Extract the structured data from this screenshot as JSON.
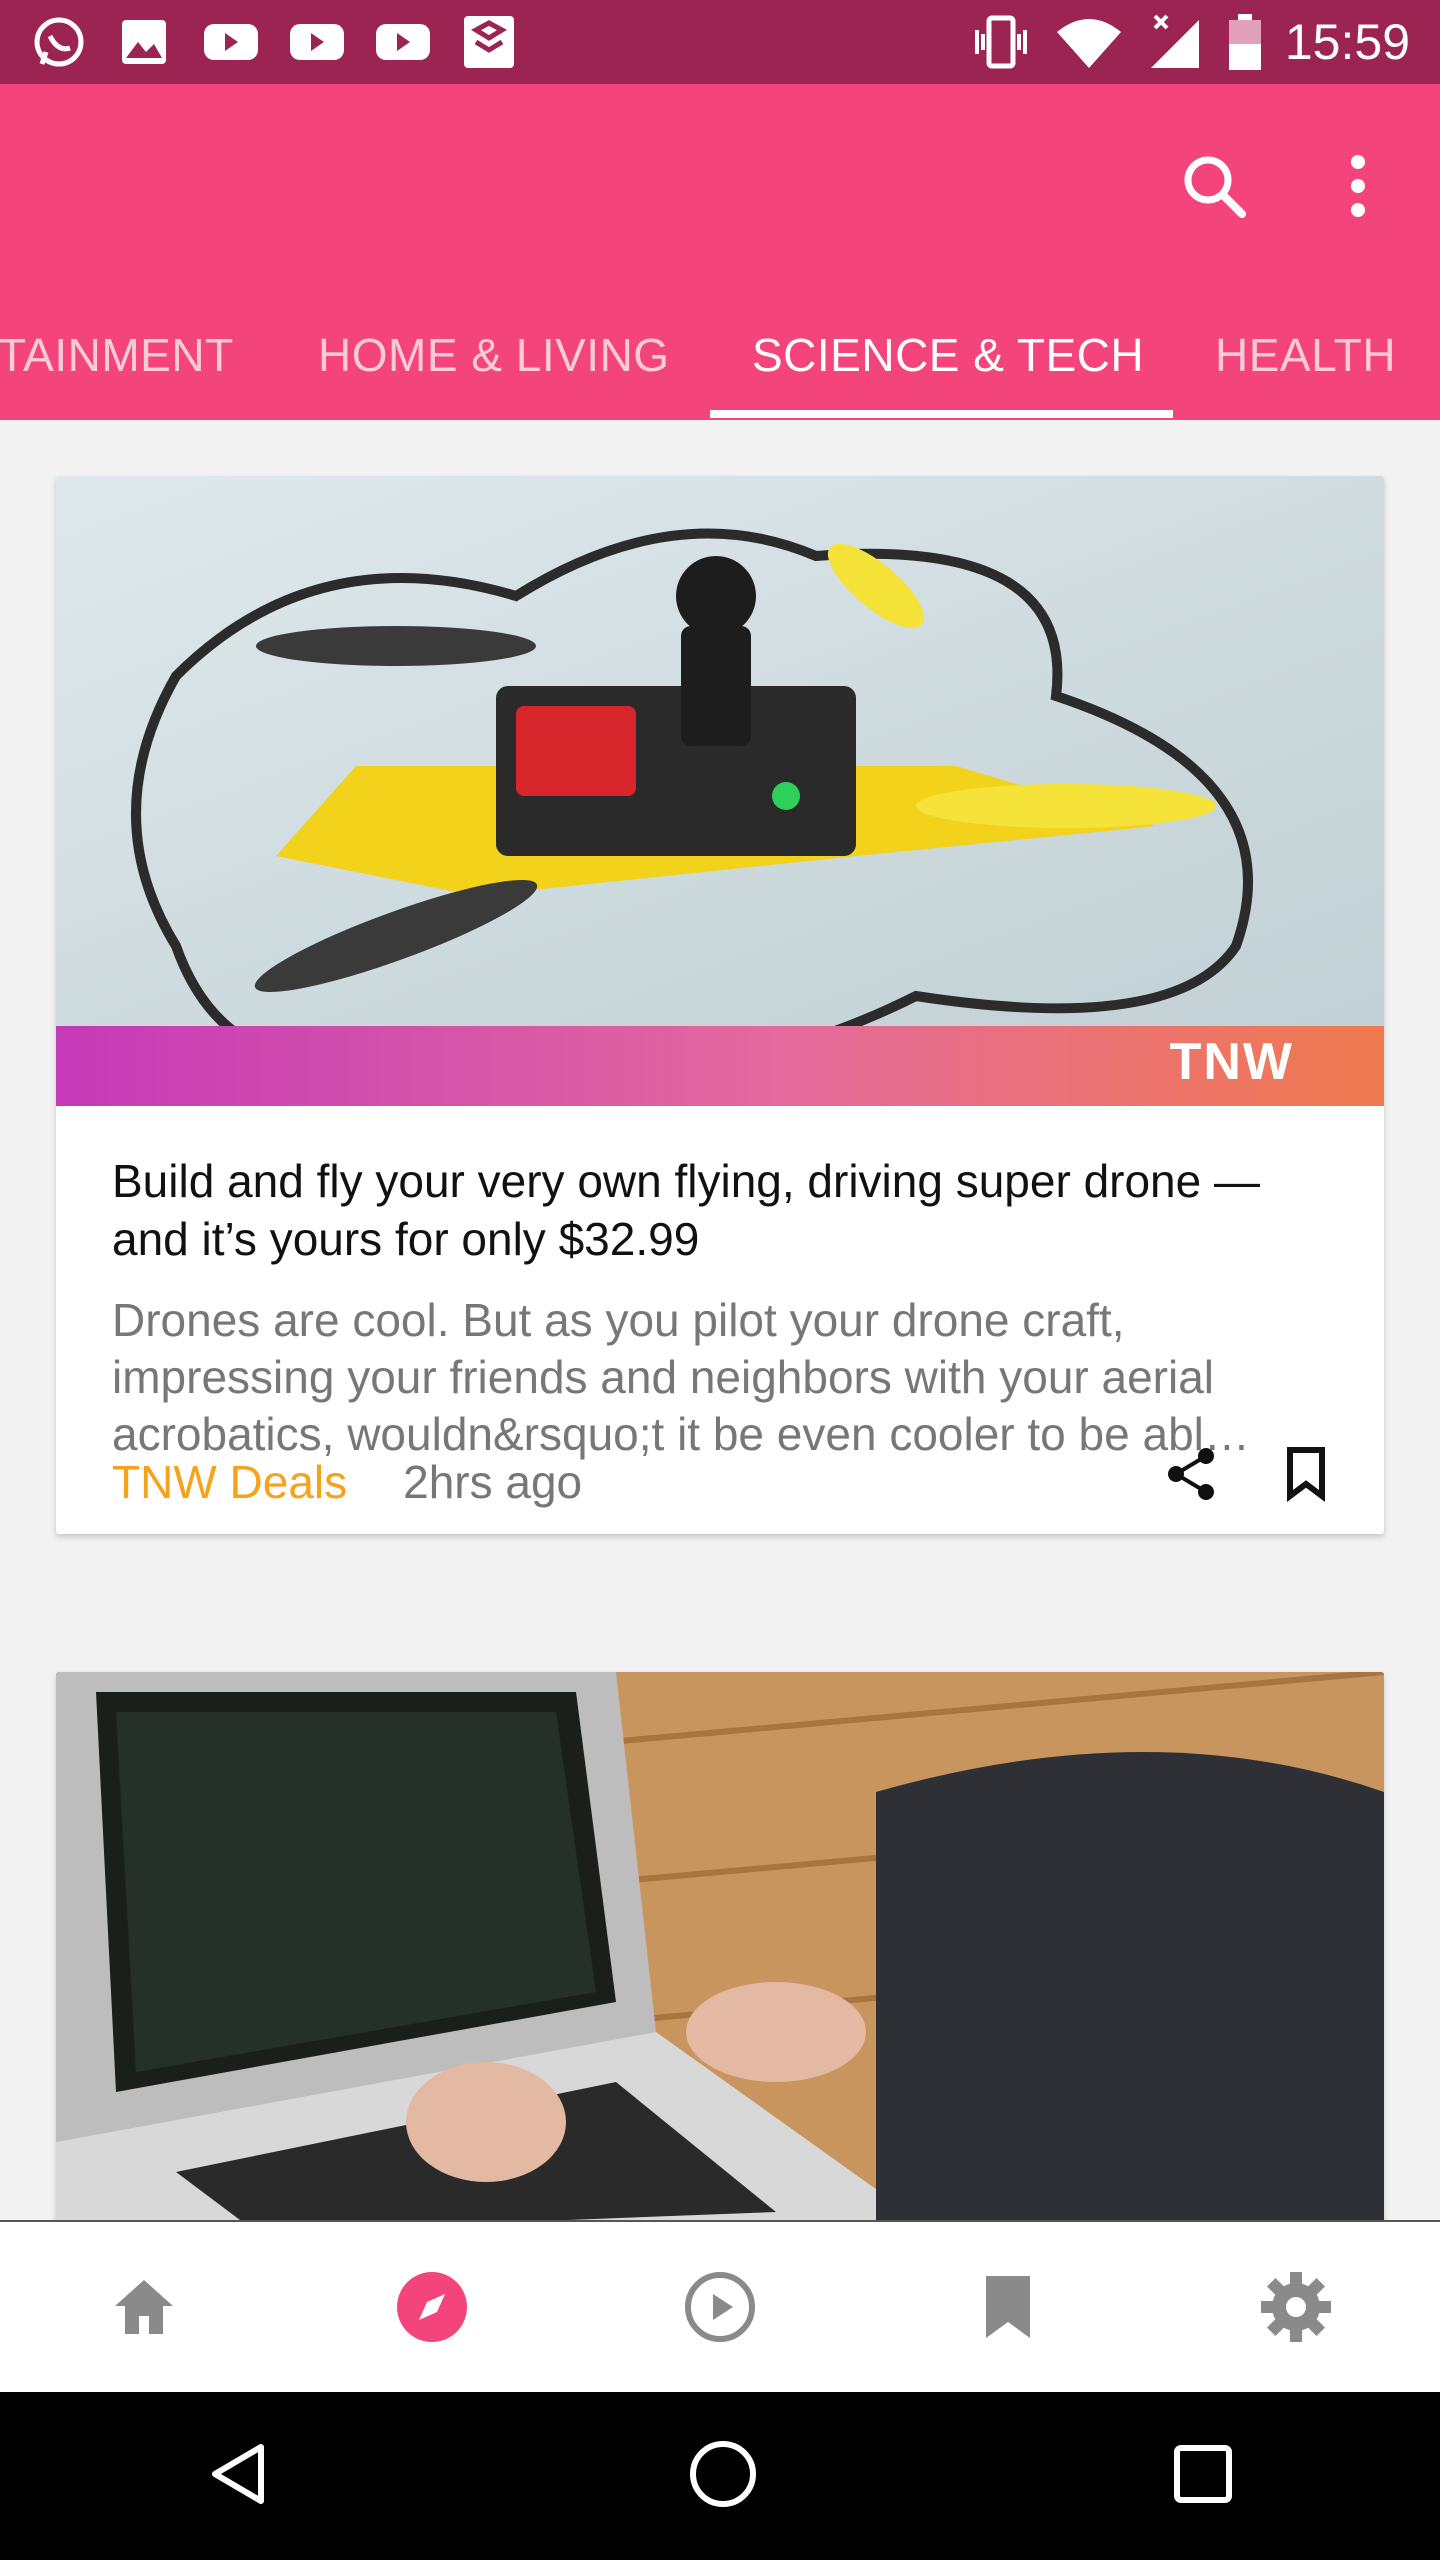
{
  "status_bar": {
    "icons": [
      "whatsapp-icon",
      "gallery-icon",
      "youtube-icon",
      "youtube-icon",
      "youtube-icon",
      "app-icon"
    ],
    "right_icons": [
      "vibrate-icon",
      "wifi-icon",
      "signal-icon",
      "battery-icon"
    ],
    "time": "15:59"
  },
  "app_bar": {
    "actions": [
      "search-icon",
      "more-vert-icon"
    ],
    "tabs": [
      {
        "label": "TAINMENT"
      },
      {
        "label": "HOME & LIVING"
      },
      {
        "label": "SCIENCE & TECH"
      },
      {
        "label": "HEALTH"
      }
    ],
    "active_tab_index": 2,
    "color": "#f3457c",
    "status_color": "#9c2452"
  },
  "feed": {
    "cards": [
      {
        "brand": "TNW",
        "title": "Build and fly your very own flying, driving super drone — and it’s yours for only $32.99",
        "description": "Drones are cool. But as you pilot your drone craft, impressing your friends and neighbors with your aerial acrobatics, wouldn&rsquo;t it be even cooler to be abl…",
        "source": "TNW Deals",
        "time": "2hrs ago",
        "actions": [
          "share-icon",
          "bookmark-icon"
        ]
      },
      {
        "image": "laptop-coding-photo"
      }
    ]
  },
  "bottom_nav": {
    "items": [
      "home-icon",
      "explore-icon",
      "play-icon",
      "bookmark-icon",
      "settings-icon"
    ],
    "active_index": 1,
    "active_color": "#f3457c",
    "inactive_color": "#8a8a8a"
  },
  "system_nav": [
    "back-icon",
    "home-circle-icon",
    "recents-icon"
  ]
}
